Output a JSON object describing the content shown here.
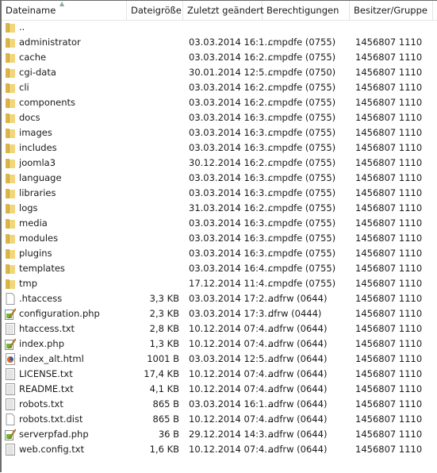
{
  "columns": {
    "name": "Dateiname",
    "size": "Dateigröße",
    "date": "Zuletzt geändert",
    "perm": "Berechtigungen",
    "owner": "Besitzer/Gruppe"
  },
  "rows": [
    {
      "icon": "folder",
      "name": "..",
      "size": "",
      "date": "",
      "perm": "",
      "owner": ""
    },
    {
      "icon": "folder",
      "name": "administrator",
      "size": "",
      "date": "03.03.2014 16:1...",
      "perm": "cmpdfe (0755)",
      "owner": "1456807 1110"
    },
    {
      "icon": "folder",
      "name": "cache",
      "size": "",
      "date": "03.03.2014 16:2...",
      "perm": "cmpdfe (0755)",
      "owner": "1456807 1110"
    },
    {
      "icon": "folder",
      "name": "cgi-data",
      "size": "",
      "date": "30.01.2014 12:5...",
      "perm": "cmpdfe (0750)",
      "owner": "1456807 1110"
    },
    {
      "icon": "folder",
      "name": "cli",
      "size": "",
      "date": "03.03.2014 16:2...",
      "perm": "cmpdfe (0755)",
      "owner": "1456807 1110"
    },
    {
      "icon": "folder",
      "name": "components",
      "size": "",
      "date": "03.03.2014 16:2...",
      "perm": "cmpdfe (0755)",
      "owner": "1456807 1110"
    },
    {
      "icon": "folder",
      "name": "docs",
      "size": "",
      "date": "03.03.2014 16:3...",
      "perm": "cmpdfe (0755)",
      "owner": "1456807 1110"
    },
    {
      "icon": "folder",
      "name": "images",
      "size": "",
      "date": "03.03.2014 16:3...",
      "perm": "cmpdfe (0755)",
      "owner": "1456807 1110"
    },
    {
      "icon": "folder",
      "name": "includes",
      "size": "",
      "date": "03.03.2014 16:3...",
      "perm": "cmpdfe (0755)",
      "owner": "1456807 1110"
    },
    {
      "icon": "folder",
      "name": "joomla3",
      "size": "",
      "date": "30.12.2014 16:2...",
      "perm": "cmpdfe (0755)",
      "owner": "1456807 1110"
    },
    {
      "icon": "folder",
      "name": "language",
      "size": "",
      "date": "03.03.2014 16:3...",
      "perm": "cmpdfe (0755)",
      "owner": "1456807 1110"
    },
    {
      "icon": "folder",
      "name": "libraries",
      "size": "",
      "date": "03.03.2014 16:3...",
      "perm": "cmpdfe (0755)",
      "owner": "1456807 1110"
    },
    {
      "icon": "folder",
      "name": "logs",
      "size": "",
      "date": "31.03.2014 16:2...",
      "perm": "cmpdfe (0755)",
      "owner": "1456807 1110"
    },
    {
      "icon": "folder",
      "name": "media",
      "size": "",
      "date": "03.03.2014 16:3...",
      "perm": "cmpdfe (0755)",
      "owner": "1456807 1110"
    },
    {
      "icon": "folder",
      "name": "modules",
      "size": "",
      "date": "03.03.2014 16:3...",
      "perm": "cmpdfe (0755)",
      "owner": "1456807 1110"
    },
    {
      "icon": "folder",
      "name": "plugins",
      "size": "",
      "date": "03.03.2014 16:3...",
      "perm": "cmpdfe (0755)",
      "owner": "1456807 1110"
    },
    {
      "icon": "folder",
      "name": "templates",
      "size": "",
      "date": "03.03.2014 16:4...",
      "perm": "cmpdfe (0755)",
      "owner": "1456807 1110"
    },
    {
      "icon": "folder",
      "name": "tmp",
      "size": "",
      "date": "17.12.2014 11:4...",
      "perm": "cmpdfe (0755)",
      "owner": "1456807 1110"
    },
    {
      "icon": "file",
      "name": ".htaccess",
      "size": "3,3 KB",
      "date": "03.03.2014 17:2...",
      "perm": "adfrw (0644)",
      "owner": "1456807 1110"
    },
    {
      "icon": "php",
      "name": "configuration.php",
      "size": "2,3 KB",
      "date": "03.03.2014 17:3...",
      "perm": "dfrw (0444)",
      "owner": "1456807 1110"
    },
    {
      "icon": "text",
      "name": "htaccess.txt",
      "size": "2,8 KB",
      "date": "10.12.2014 07:4...",
      "perm": "adfrw (0644)",
      "owner": "1456807 1110"
    },
    {
      "icon": "php",
      "name": "index.php",
      "size": "1,3 KB",
      "date": "10.12.2014 07:4...",
      "perm": "adfrw (0644)",
      "owner": "1456807 1110"
    },
    {
      "icon": "html",
      "name": "index_alt.html",
      "size": "1001 B",
      "date": "03.03.2014 12:5...",
      "perm": "adfrw (0644)",
      "owner": "1456807 1110"
    },
    {
      "icon": "text",
      "name": "LICENSE.txt",
      "size": "17,4 KB",
      "date": "10.12.2014 07:4...",
      "perm": "adfrw (0644)",
      "owner": "1456807 1110"
    },
    {
      "icon": "text",
      "name": "README.txt",
      "size": "4,1 KB",
      "date": "10.12.2014 07:4...",
      "perm": "adfrw (0644)",
      "owner": "1456807 1110"
    },
    {
      "icon": "text",
      "name": "robots.txt",
      "size": "865 B",
      "date": "03.03.2014 16:1...",
      "perm": "adfrw (0644)",
      "owner": "1456807 1110"
    },
    {
      "icon": "file",
      "name": "robots.txt.dist",
      "size": "865 B",
      "date": "10.12.2014 07:4...",
      "perm": "adfrw (0644)",
      "owner": "1456807 1110"
    },
    {
      "icon": "php",
      "name": "serverpfad.php",
      "size": "36 B",
      "date": "29.12.2014 14:3...",
      "perm": "adfrw (0644)",
      "owner": "1456807 1110"
    },
    {
      "icon": "text",
      "name": "web.config.txt",
      "size": "1,6 KB",
      "date": "10.12.2014 07:4...",
      "perm": "adfrw (0644)",
      "owner": "1456807 1110"
    }
  ]
}
